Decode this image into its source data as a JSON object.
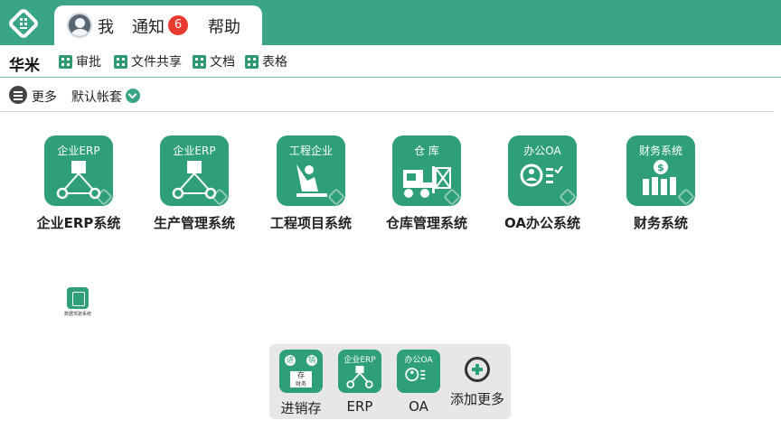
{
  "header": {
    "tabs": [
      {
        "label": "我",
        "icon": "user-avatar-icon"
      },
      {
        "label": "通知",
        "badge": "6"
      },
      {
        "label": "帮助"
      }
    ]
  },
  "toolbar": {
    "org": "华米",
    "links": [
      "审批",
      "文件共享",
      "文档",
      "表格"
    ]
  },
  "subbar": {
    "more": "更多",
    "account": "默认帐套"
  },
  "apps": [
    {
      "caption": "企业ERP",
      "label": "企业ERP系统"
    },
    {
      "caption": "企业ERP",
      "label": "生产管理系统"
    },
    {
      "caption": "工程企业",
      "label": "工程项目系统"
    },
    {
      "caption": "仓 库",
      "label": "仓库管理系统"
    },
    {
      "caption": "办公OA",
      "label": "OA办公系统"
    },
    {
      "caption": "财务系统",
      "label": "财务系统"
    }
  ],
  "mini_app": {
    "label": "数据驾驶系统"
  },
  "dock": {
    "items": [
      {
        "caption_left": "进",
        "caption_right": "销",
        "caption_mid": "存",
        "caption_bottom": "财务",
        "label": "进销存"
      },
      {
        "caption": "企业ERP",
        "label": "ERP"
      },
      {
        "caption": "办公OA",
        "label": "OA"
      }
    ],
    "add_label": "添加更多"
  },
  "colors": {
    "brand": "#3aa487",
    "icon_bg": "#2e9f78",
    "badge": "#e83a2e"
  }
}
